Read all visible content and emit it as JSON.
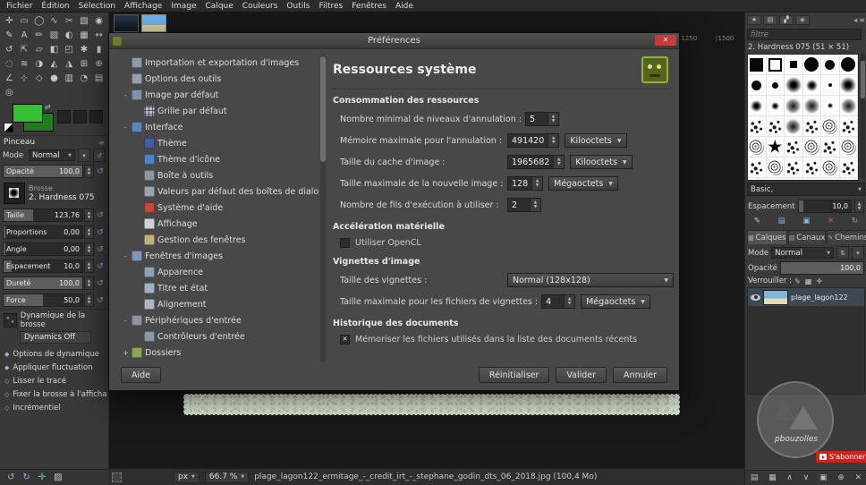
{
  "colors": {
    "foreground": "#35c035",
    "background_swatch": "#1e7d1e",
    "close_button": "#c43c3c",
    "subscribe_red": "#cc241d"
  },
  "menubar": {
    "items": [
      "Fichier",
      "Édition",
      "Sélection",
      "Affichage",
      "Image",
      "Calque",
      "Couleurs",
      "Outils",
      "Filtres",
      "Fenêtres",
      "Aide"
    ]
  },
  "toolbox": {
    "tools": [
      "✛",
      "▭",
      "◯",
      "∿",
      "✂",
      "▧",
      "◉",
      "✎",
      "A",
      "✏",
      "▨",
      "◐",
      "▦",
      "↔",
      "↺",
      "⇱",
      "▱",
      "◧",
      "◰",
      "✱",
      "▮",
      "◌",
      "≋",
      "◑",
      "◭",
      "◮",
      "⊞",
      "⊕",
      "∠",
      "⊹",
      "◇",
      "●",
      "▥",
      "◔",
      "▤",
      "◎"
    ],
    "section_title": "Pinceau",
    "mode_label": "Mode",
    "mode_value": "Normal",
    "opacity_label": "Opacité",
    "opacity_value": "100,0",
    "opacity_fill": 100,
    "brush_label": "Brosse",
    "brush_name": "2. Hardness 075",
    "sliders": [
      {
        "label": "Taille",
        "value": "123,76",
        "fill": 38
      },
      {
        "label": "Proportions",
        "value": "0,00",
        "fill": 2
      },
      {
        "label": "Angle",
        "value": "0,00",
        "fill": 2
      },
      {
        "label": "Espacement",
        "value": "10,0",
        "fill": 10
      },
      {
        "label": "Dureté",
        "value": "100,0",
        "fill": 100
      },
      {
        "label": "Force",
        "value": "50,0",
        "fill": 50
      }
    ],
    "dynamics_label": "Dynamique de la brosse",
    "dynamics_value": "Dynamics Off",
    "options": [
      {
        "m": "◆",
        "label": "Options de dynamique"
      },
      {
        "m": "◆",
        "label": "Appliquer fluctuation"
      },
      {
        "m": "◇",
        "label": "Lisser le tracé"
      },
      {
        "m": "◇",
        "label": "Fixer la brosse à l'affichage"
      },
      {
        "m": "◇",
        "label": "Incrémentiel"
      }
    ],
    "bottom_icons": [
      {
        "g": "↺",
        "c": "c-blue"
      },
      {
        "g": "↻",
        "c": "c-blue"
      },
      {
        "g": "✛",
        "c": "c-teal"
      },
      {
        "g": "▨",
        "c": "c-gray"
      }
    ]
  },
  "canvas": {
    "ruler_ticks": [
      "1250",
      "1500"
    ]
  },
  "dialog": {
    "title": "Préférences",
    "tree": [
      {
        "lvl": "l0",
        "exp": "",
        "icon": "ic-import",
        "label": "Importation et exportation d'images"
      },
      {
        "lvl": "l0",
        "exp": "",
        "icon": "ic-tools",
        "label": "Options des outils"
      },
      {
        "lvl": "l0",
        "exp": "-",
        "icon": "ic-image",
        "label": "Image par défaut"
      },
      {
        "lvl": "l1",
        "exp": "",
        "icon": "ic-grid",
        "label": "Grille par défaut"
      },
      {
        "lvl": "l0",
        "exp": "-",
        "icon": "ic-iface",
        "label": "Interface"
      },
      {
        "lvl": "l1",
        "exp": "",
        "icon": "ic-theme",
        "label": "Thème"
      },
      {
        "lvl": "l1",
        "exp": "",
        "icon": "ic-icontheme",
        "label": "Thème d'icône"
      },
      {
        "lvl": "l1",
        "exp": "",
        "icon": "ic-toolbox",
        "label": "Boîte à outils"
      },
      {
        "lvl": "l1",
        "exp": "",
        "icon": "ic-dialogdef",
        "label": "Valeurs par défaut des boîtes de dialogue"
      },
      {
        "lvl": "l1",
        "exp": "",
        "icon": "ic-help",
        "label": "Système d'aide"
      },
      {
        "lvl": "l1",
        "exp": "",
        "icon": "ic-display",
        "label": "Affichage"
      },
      {
        "lvl": "l1",
        "exp": "",
        "icon": "ic-winmgmt",
        "label": "Gestion des fenêtres"
      },
      {
        "lvl": "l0",
        "exp": "-",
        "icon": "ic-imgwin",
        "label": "Fenêtres d'images"
      },
      {
        "lvl": "l1",
        "exp": "",
        "icon": "ic-appear",
        "label": "Apparence"
      },
      {
        "lvl": "l1",
        "exp": "",
        "icon": "ic-title",
        "label": "Titre et état"
      },
      {
        "lvl": "l1",
        "exp": "",
        "icon": "ic-align",
        "label": "Alignement"
      },
      {
        "lvl": "l0",
        "exp": "-",
        "icon": "ic-inputdev",
        "label": "Périphériques d'entrée"
      },
      {
        "lvl": "l1",
        "exp": "",
        "icon": "ic-inputctl",
        "label": "Contrôleurs d'entrée"
      },
      {
        "lvl": "l0",
        "exp": "+",
        "icon": "ic-folders",
        "label": "Dossiers"
      }
    ],
    "page": {
      "title": "Ressources système",
      "sec_resources": "Consommation des ressources",
      "rows": [
        {
          "label": "Nombre minimal de niveaux d'annulation :",
          "value": "5"
        },
        {
          "label": "Mémoire maximale pour l'annulation :",
          "value": "491420",
          "unit": "Kilooctets"
        },
        {
          "label": "Taille du cache d'image :",
          "value": "1965682",
          "unit": "Kilooctets"
        },
        {
          "label": "Taille maximale de la nouvelle image :",
          "value": "128",
          "unit": "Mégaoctets"
        },
        {
          "label": "Nombre de fils d'exécution à utiliser :",
          "value": "2"
        }
      ],
      "sec_hardware": "Accélération matérielle",
      "opencl_label": "Utiliser OpenCL",
      "sec_thumbs": "Vignettes d'image",
      "thumb_size_label": "Taille des vignettes :",
      "thumb_size_value": "Normal (128x128)",
      "thumb_file_label": "Taille maximale pour les fichiers de vignettes :",
      "thumb_file_value": "4",
      "thumb_file_unit": "Mégaoctets",
      "sec_history": "Historique des documents",
      "history_label": "Mémoriser les fichiers utilisés dans la liste des documents récents"
    },
    "buttons": {
      "help": "Aide",
      "reset": "Réinitialiser",
      "ok": "Valider",
      "cancel": "Annuler"
    }
  },
  "dock": {
    "tab_icons": [
      "★",
      "▤",
      "▞",
      "◈"
    ],
    "menu_icons": [
      "◂",
      "≡"
    ],
    "filter_placeholder": "filtre",
    "brush_title": "2. Hardness 075 (51 × 51)",
    "brushes": [
      "b-sqf",
      "b-sqo",
      "b-sqs",
      "b-cl",
      "b-cm",
      "b-cl",
      "b-cm",
      "b-cs",
      "b-sl",
      "b-sm",
      "b-cxs",
      "b-sl",
      "b-sm",
      "b-ss",
      "b-fz",
      "b-fz",
      "b-sxs",
      "b-fz",
      "b-nz",
      "b-nz",
      "b-fz",
      "b-nz",
      "b-gr",
      "b-nz",
      "b-gr",
      "b-st",
      "b-nz",
      "b-gr",
      "b-nz",
      "b-gr",
      "b-nz",
      "b-gr",
      "b-nz",
      "b-nz",
      "b-gr",
      "b-nz"
    ],
    "tag_value": "Basic,",
    "spacing_label": "Espacement",
    "spacing_value": "10,0",
    "spacing_fill": 10,
    "action_icons": [
      {
        "g": "✎",
        "c": "c-gray"
      },
      {
        "g": "▤",
        "c": "c-blue"
      },
      {
        "g": "▣",
        "c": "c-blue"
      },
      {
        "g": "✕",
        "c": "c-red"
      },
      {
        "g": "↻",
        "c": "c-green"
      }
    ],
    "layer_tabs": [
      {
        "icon": "▦",
        "label": "Calques",
        "cls": "active"
      },
      {
        "icon": "▤",
        "label": "Canaux",
        "cls": ""
      },
      {
        "icon": "✎",
        "label": "Chemins",
        "cls": ""
      }
    ],
    "mode_label": "Mode",
    "mode_value": "Normal",
    "opacity_label": "Opacité",
    "opacity_value": "100,0",
    "opacity_fill": 100,
    "lock_label": "Verrouiller :",
    "lock_icons": [
      "✎",
      "▦",
      "✛"
    ],
    "layer_name": "plage_lagon122",
    "bottom_icons": [
      "▤",
      "▦",
      "∧",
      "∨",
      "▣",
      "⊕",
      "✕"
    ]
  },
  "statusbar": {
    "unit": "px",
    "zoom": "66.7 %",
    "filename": "plage_lagon122_ermitage_-_credit_irt_-_stephane_godin_dts_06_2018.jpg (100,4 Mo)"
  },
  "overlays": {
    "watermark_text": "pbouzolles",
    "subscribe_label": "S'abonner"
  }
}
